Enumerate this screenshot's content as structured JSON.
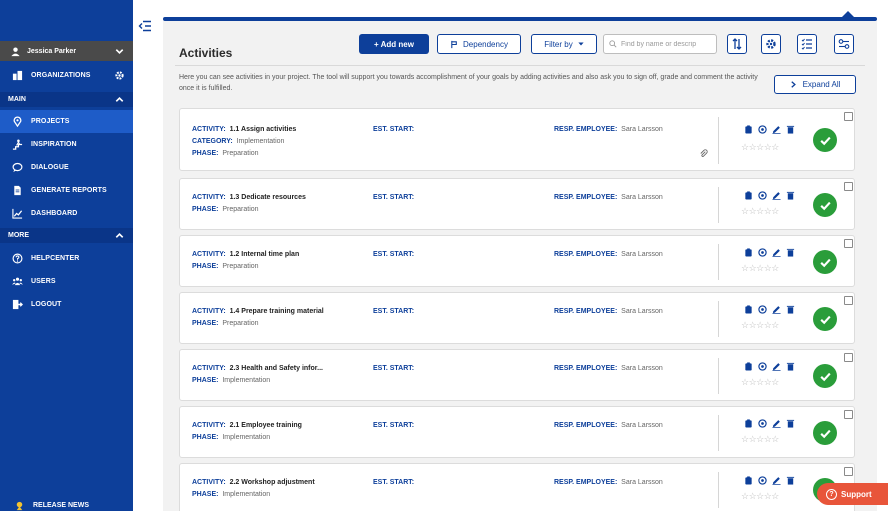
{
  "user": {
    "name": "Jessica Parker"
  },
  "sidebar": {
    "organizations": "ORGANIZATIONS",
    "section_main": "MAIN",
    "main_items": [
      {
        "label": "PROJECTS",
        "icon": "location-pin-icon",
        "active": true
      },
      {
        "label": "INSPIRATION",
        "icon": "person-stairs-icon"
      },
      {
        "label": "DIALOGUE",
        "icon": "speech-bubble-icon"
      },
      {
        "label": "GENERATE REPORTS",
        "icon": "document-icon"
      },
      {
        "label": "DASHBOARD",
        "icon": "line-chart-icon"
      }
    ],
    "section_more": "MORE",
    "more_items": [
      {
        "label": "HELPCENTER",
        "icon": "help-circle-icon"
      },
      {
        "label": "USERS",
        "icon": "users-icon"
      },
      {
        "label": "LOGOUT",
        "icon": "logout-icon"
      }
    ],
    "release_news": "RELEASE NEWS"
  },
  "toolbar": {
    "title": "Activities",
    "add_new": "+ Add new",
    "dependency": "Dependency",
    "filter_by": "Filter by",
    "search_placeholder": "Find by name or descrip"
  },
  "description": "Here you can see activities in your project. The tool will support you towards accomplishment of your goals by adding activities and also ask you to sign off, grade and comment the activity once it is fulfilled.",
  "expand_all": "Expand All",
  "labels": {
    "activity": "ACTIVITY:",
    "category": "CATEGORY:",
    "phase": "PHASE:",
    "est_start": "EST. START:",
    "resp_employee": "RESP. EMPLOYEE:"
  },
  "activities": [
    {
      "name": "1.1 Assign activities",
      "category": "Implementation",
      "phase": "Preparation",
      "employee": "Sara Larsson"
    },
    {
      "name": "1.3 Dedicate resources",
      "phase": "Preparation",
      "employee": "Sara Larsson"
    },
    {
      "name": "1.2 Internal time plan",
      "phase": "Preparation",
      "employee": "Sara Larsson"
    },
    {
      "name": "1.4 Prepare training material",
      "phase": "Preparation",
      "employee": "Sara Larsson"
    },
    {
      "name": "2.3 Health and Safety infor...",
      "phase": "Implementation",
      "employee": "Sara Larsson"
    },
    {
      "name": "2.1 Employee training",
      "phase": "Implementation",
      "employee": "Sara Larsson"
    },
    {
      "name": "2.2 Workshop adjustment",
      "phase": "Implementation",
      "employee": "Sara Larsson"
    }
  ],
  "stars": "☆☆☆☆☆",
  "support": "Support",
  "colors": {
    "brand": "#0d3f9a",
    "success": "#2a9d3a",
    "support": "#e8553a"
  }
}
